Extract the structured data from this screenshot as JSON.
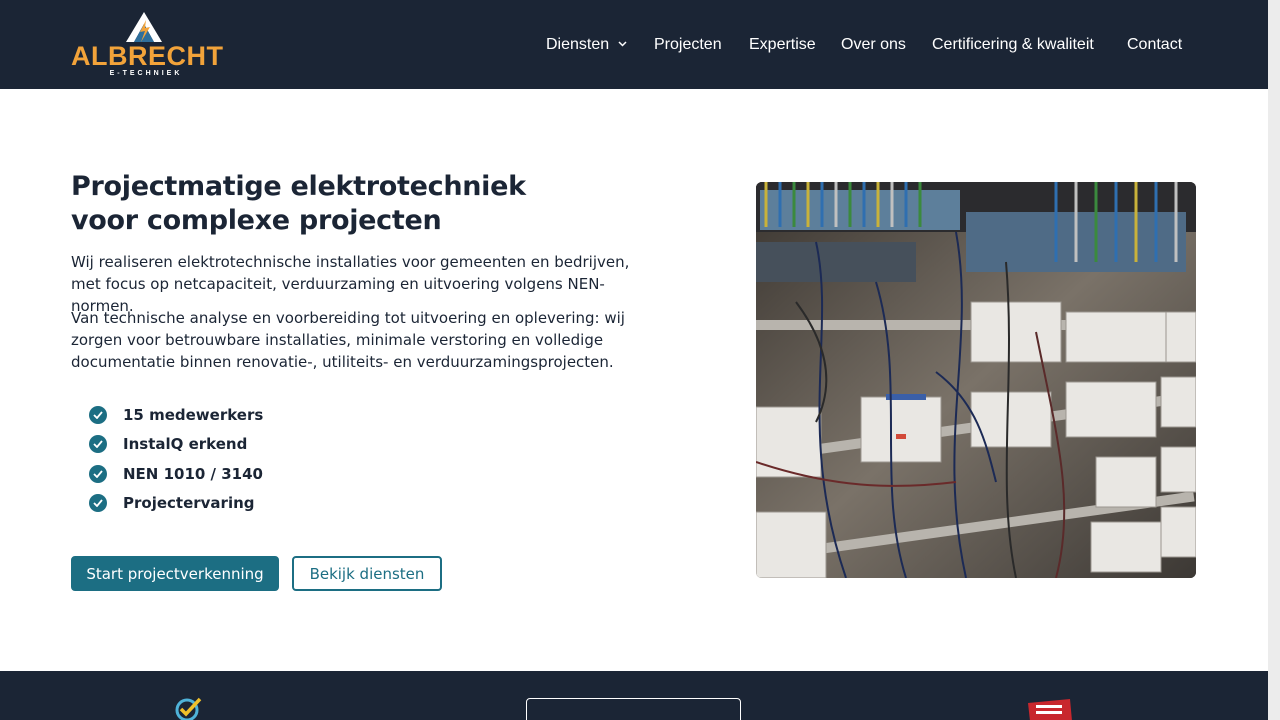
{
  "header": {
    "logo": {
      "name": "ALBRECHT",
      "tagline": "E-TECHNIEK"
    },
    "nav": [
      {
        "label": "Diensten",
        "has_dropdown": true,
        "icon": "chevron-down-icon"
      },
      {
        "label": "Projecten"
      },
      {
        "label": "Expertise"
      },
      {
        "label": "Over ons"
      },
      {
        "label": "Certificering & kwaliteit"
      },
      {
        "label": "Contact"
      }
    ]
  },
  "hero": {
    "title_line1": "Projectmatige elektrotechniek",
    "title_line2": "voor complexe projecten",
    "paragraph1": "Wij realiseren elektrotechnische installaties voor gemeenten en bedrijven, met focus op netcapaciteit, verduurzaming en uitvoering volgens NEN-normen.",
    "paragraph2": "Van technische analyse en voorbereiding tot uitvoering en oplevering: wij zorgen voor betrouwbare installaties, minimale verstoring en volledige documentatie binnen renovatie-, utiliteits- en verduurzamingsprojecten.",
    "features": [
      {
        "label": "15 medewerkers",
        "icon": "check-circle-icon"
      },
      {
        "label": "InstalQ erkend",
        "icon": "check-circle-icon"
      },
      {
        "label": "NEN 1010 / 3140",
        "icon": "check-circle-icon"
      },
      {
        "label": "Projectervaring",
        "icon": "check-circle-icon"
      }
    ],
    "primary_button": "Start projectverkenning",
    "secondary_button": "Bekijk diensten",
    "image": "electrical-cabinet-photo"
  },
  "colors": {
    "navy": "#1b2535",
    "teal": "#1c6e83",
    "logo_orange": "#f2a33a",
    "white": "#ffffff"
  }
}
